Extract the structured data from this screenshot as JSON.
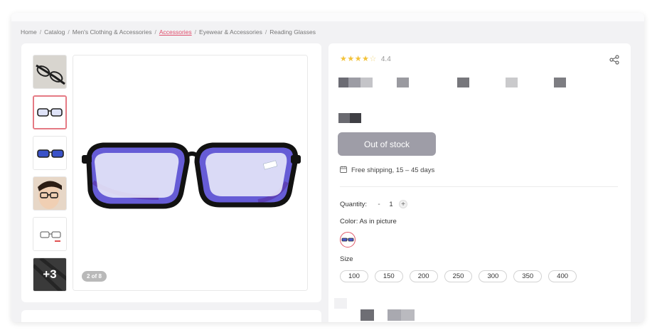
{
  "breadcrumb": [
    "Home",
    "Catalog",
    "Men's Clothing & Accessories",
    "Accessories",
    "Eyewear & Accessories",
    "Reading Glasses"
  ],
  "breadcrumb_active_index": 3,
  "gallery": {
    "more_label": "+3",
    "counter_label": "2 of 8",
    "thumbnails": [
      "glasses-angle",
      "glasses-front",
      "glasses-front-blue",
      "person-wearing-glasses",
      "glasses-sketch",
      "more-images"
    ]
  },
  "product": {
    "rating": 4.4,
    "rating_label": "4.4",
    "out_of_stock_label": "Out of stock",
    "shipping_text": "Free shipping, 15 – 45 days",
    "quantity_label": "Quantity:",
    "quantity_value": "1",
    "quantity_minus": "-",
    "quantity_plus": "+",
    "color_label": "Color: As in picture",
    "size_label": "Size",
    "sizes": [
      "100",
      "150",
      "200",
      "250",
      "300",
      "350",
      "400"
    ]
  },
  "colors": {
    "accent": "#e0506e",
    "button_disabled": "#9e9da7",
    "star": "#f3c238"
  },
  "icons": [
    "share-icon",
    "calendar-icon",
    "star-icon"
  ]
}
